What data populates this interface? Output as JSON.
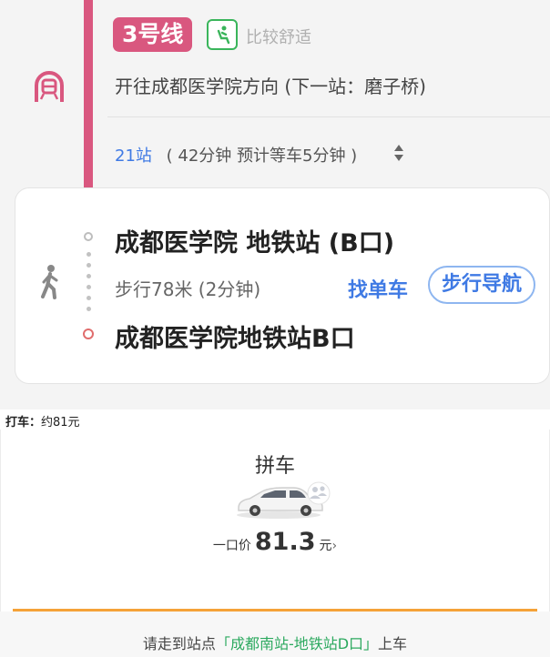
{
  "subway": {
    "line_badge": "3号线",
    "comfort_icon": "seat-person-icon",
    "comfort_text": "比较舒适",
    "direction": "开往成都医学院方向 (下一站：磨子桥)",
    "stops_count": "21站",
    "stops_detail": "( 42分钟 预计等车5分钟 )",
    "line_color": "#d9577f"
  },
  "walk": {
    "origin": "成都医学院 地铁站 (B口)",
    "walk_info": "步行78米 (2分钟)",
    "find_bike": "找单车",
    "walk_nav": "步行导航",
    "destination": "成都医学院地铁站B口"
  },
  "taxi": {
    "label": "打车：",
    "value": "约81元"
  },
  "ride": {
    "title": "拼车",
    "price_label": "一口价",
    "price": "81.3",
    "unit": "元",
    "arrow": "›",
    "hint_prefix": "请走到站点",
    "hint_station": "「成都南站-地铁站D口」",
    "hint_suffix": "上车",
    "accent_color": "#f5a238"
  }
}
